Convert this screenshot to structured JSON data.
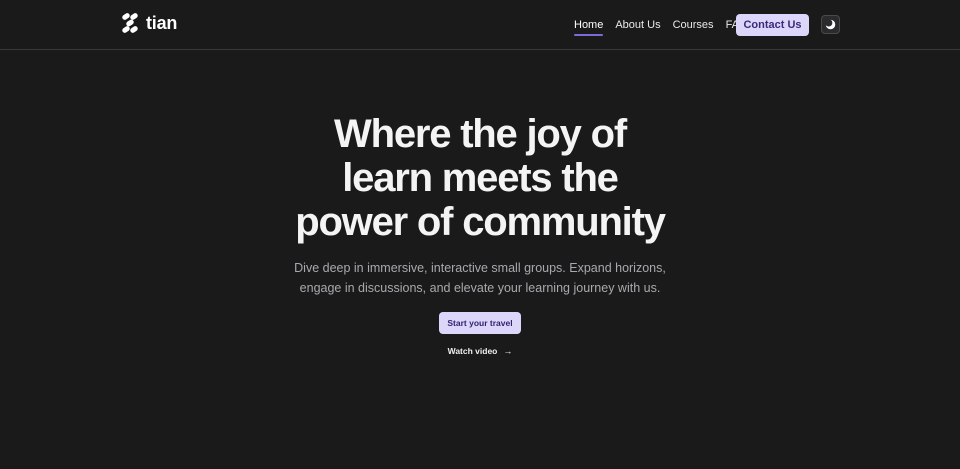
{
  "header": {
    "logo_text": "tian",
    "nav": [
      {
        "label": "Home",
        "active": true
      },
      {
        "label": "About Us",
        "active": false
      },
      {
        "label": "Courses",
        "active": false
      },
      {
        "label": "FAQ",
        "active": false
      }
    ],
    "contact_label": "Contact Us",
    "theme_toggle_icon": "moon-icon"
  },
  "hero": {
    "title_lines": [
      "Where the joy of",
      "learn meets the",
      "power of community"
    ],
    "subtitle": "Dive deep in immersive, interactive small groups. Expand horizons, engage in discussions, and elevate your learning journey with us.",
    "cta_label": "Start your travel",
    "watch_label": "Watch video",
    "watch_icon": "arrow-right-icon"
  },
  "colors": {
    "background": "#1b1a1b",
    "accent": "#ddd6fb",
    "accent_text": "#3a2a78",
    "nav_underline": "#7c6ad8"
  }
}
